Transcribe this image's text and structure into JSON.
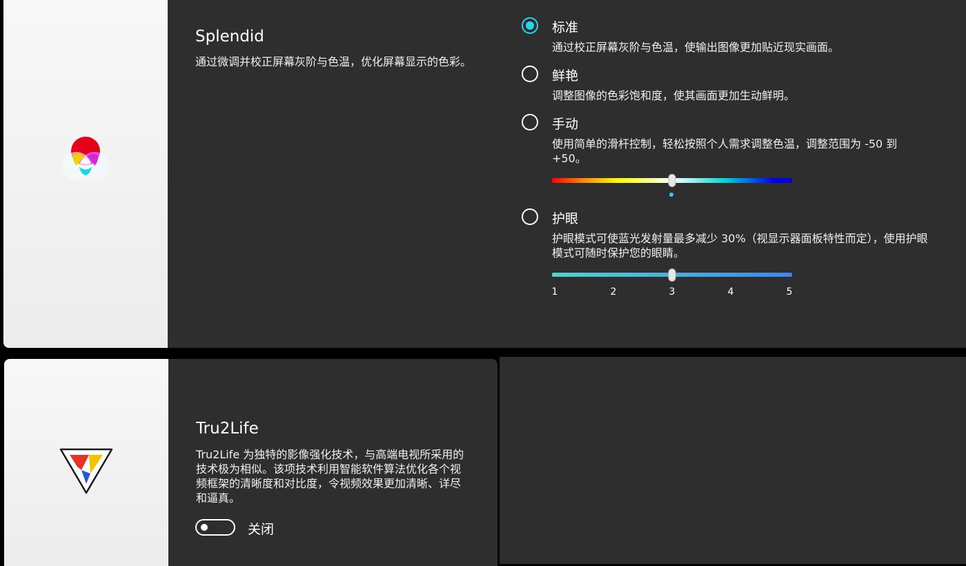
{
  "splendid": {
    "title": "Splendid",
    "description": "通过微调并校正屏幕灰阶与色温，优化屏幕显示的色彩。",
    "icon": "rgb-circles-icon",
    "selected": "standard",
    "options": [
      {
        "id": "standard",
        "label": "标准",
        "description": "通过校正屏幕灰阶与色温，使输出图像更加贴近现实画面。"
      },
      {
        "id": "vivid",
        "label": "鲜艳",
        "description": "调整图像的色彩饱和度，使其画面更加生动鲜明。"
      },
      {
        "id": "manual",
        "label": "手动",
        "description": "使用简单的滑杆控制，轻松按照个人需求调整色温，调整范围为 -50 到 +50。"
      },
      {
        "id": "eyecare",
        "label": "护眼",
        "description": "护眼模式可使蓝光发射量最多减少 30%（视显示器面板特性而定），使用护眼模式可随时保护您的眼睛。"
      }
    ],
    "temperature_slider": {
      "min": -50,
      "max": 50,
      "value": 0
    },
    "eyecare_slider": {
      "min": 1,
      "max": 5,
      "value": 3,
      "ticks": [
        "1",
        "2",
        "3",
        "4",
        "5"
      ]
    }
  },
  "tru2life": {
    "title": "Tru2Life",
    "description": "Tru2Life 为独特的影像强化技术，与高端电视所采用的技术极为相似。该项技术利用智能软件算法优化各个视频框架的清晰度和对比度，令视频效果更加清晰、详尽和逼真。",
    "icon": "tru2life-triangle-icon",
    "toggle_on": false,
    "toggle_label": "关闭"
  },
  "colors": {
    "accent": "#25d7ee",
    "panel_bg": "#2e2e2e",
    "icon_panel_bg": "#f2f2f2"
  }
}
